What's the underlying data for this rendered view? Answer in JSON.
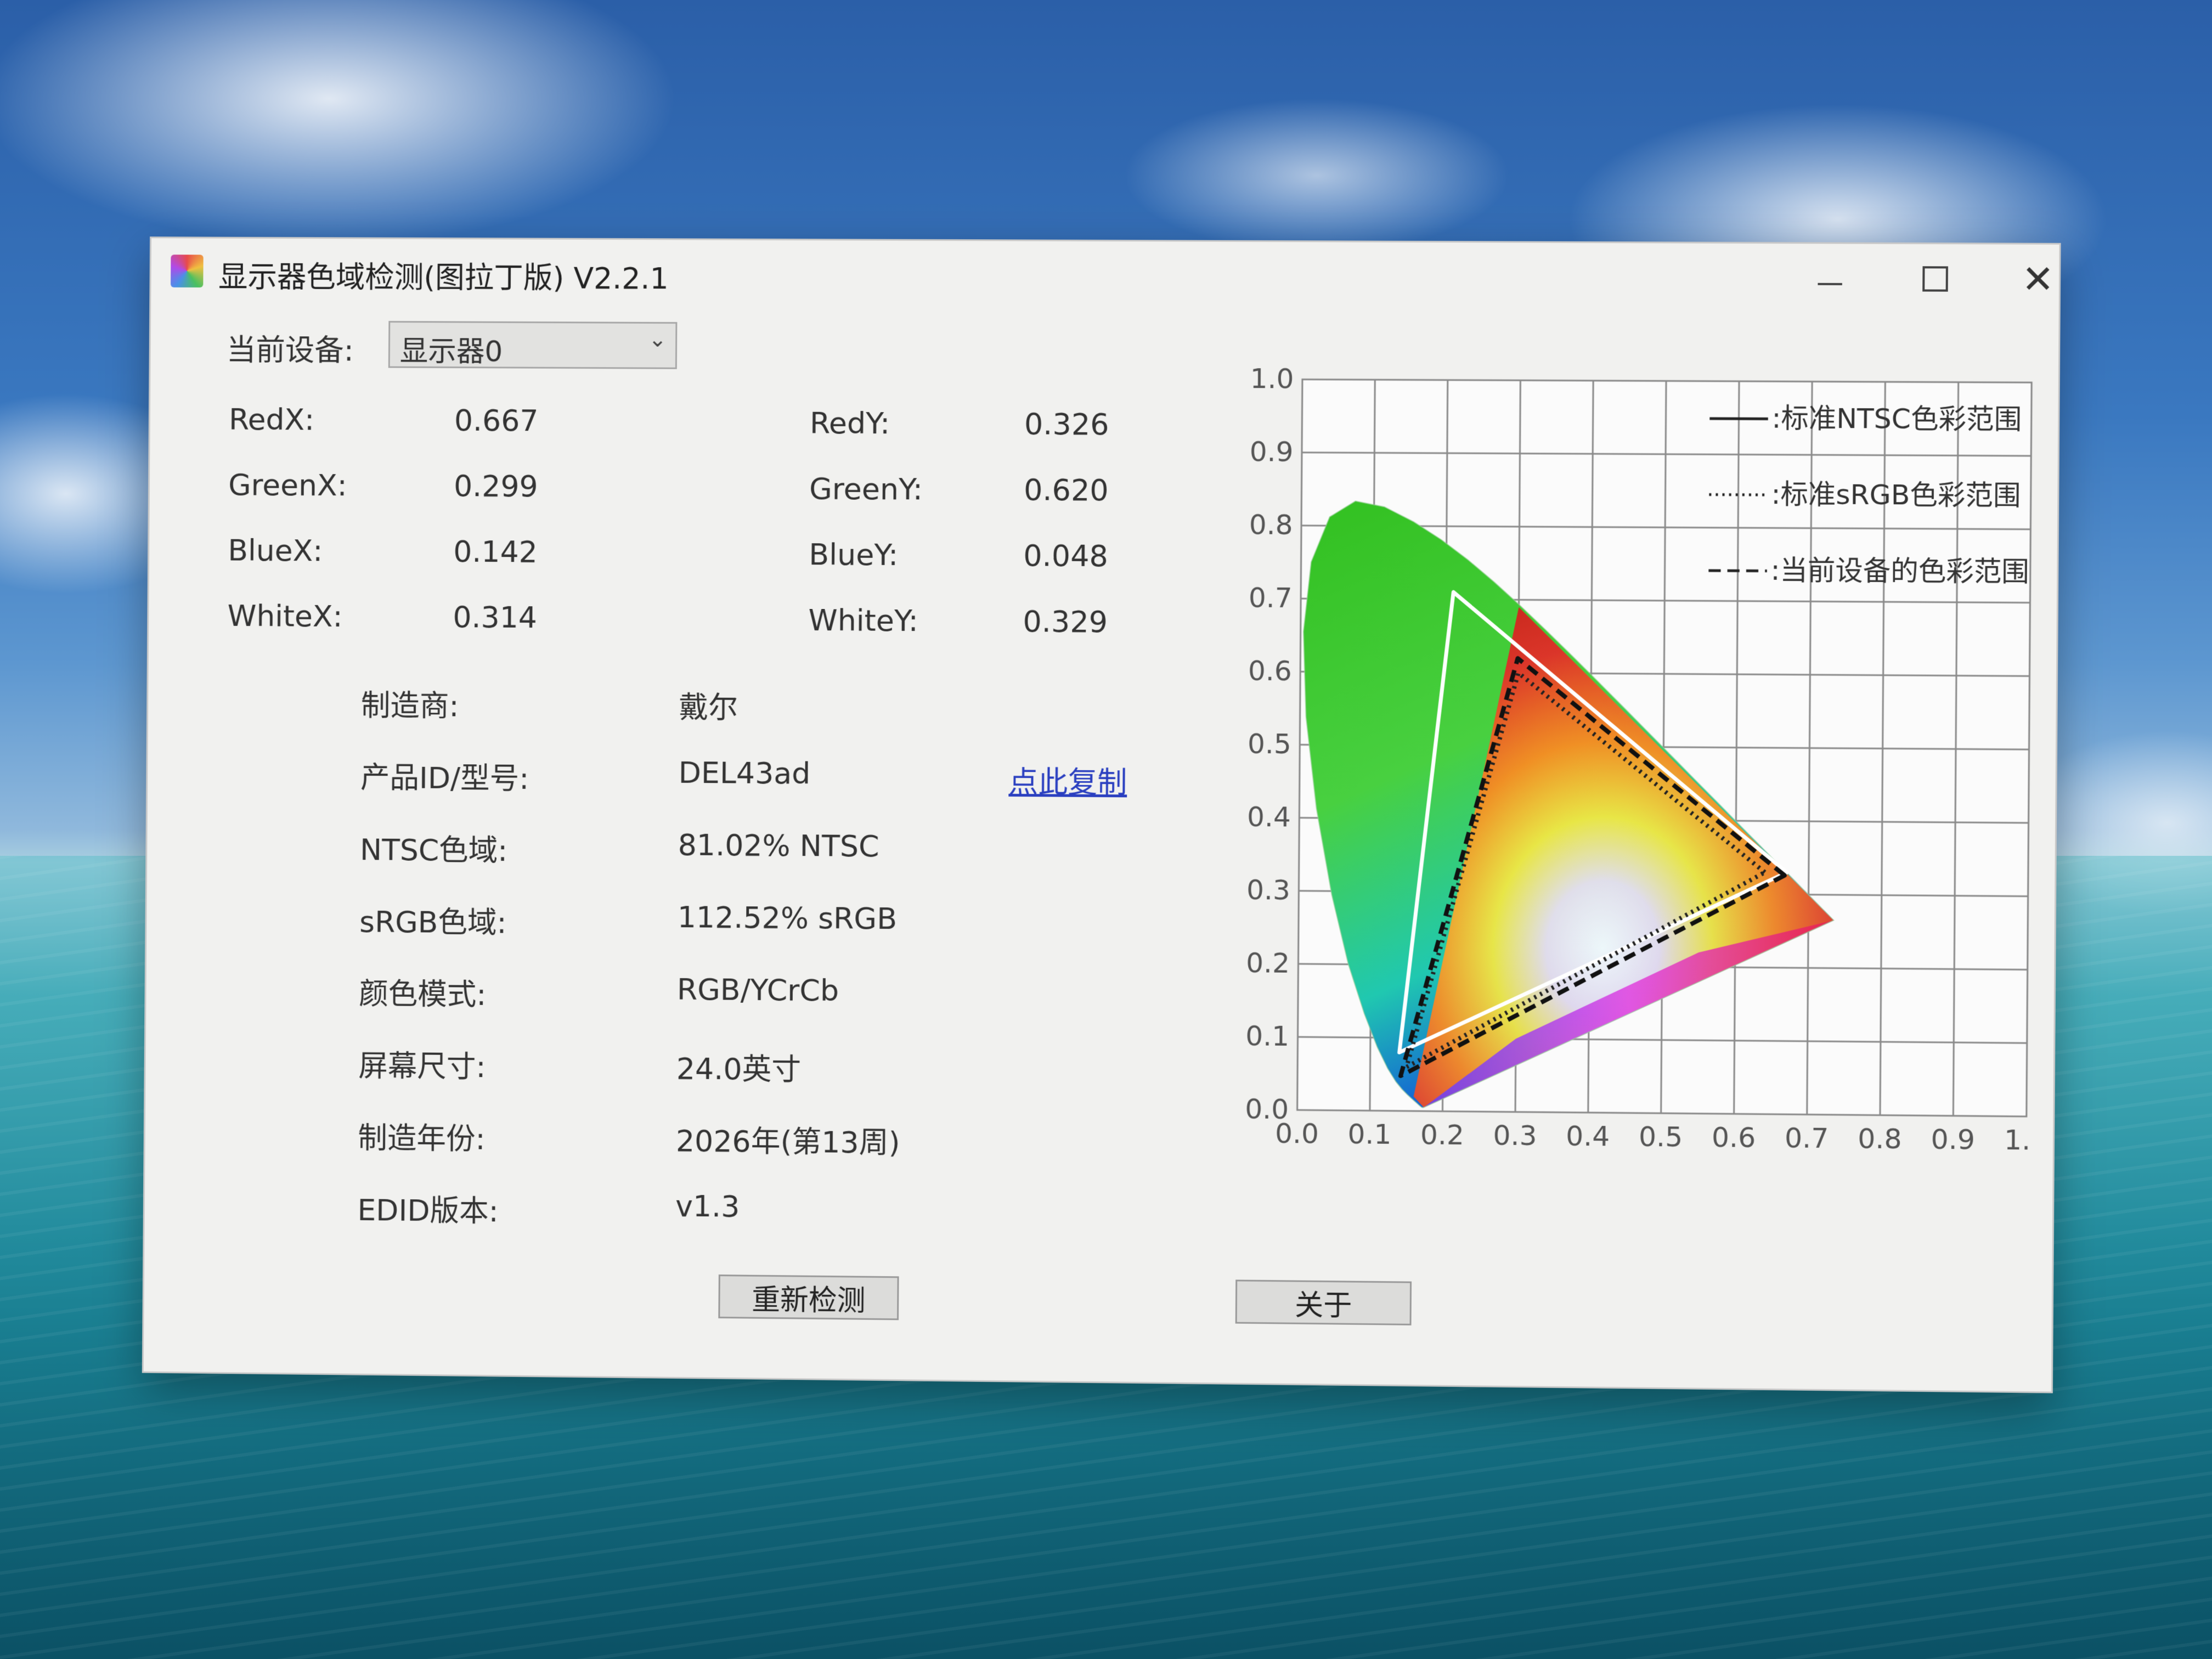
{
  "window": {
    "title": "显示器色域检测(图拉丁版) V2.2.1",
    "controls": {
      "minimize": "—",
      "maximize": "☐",
      "close": "✕"
    }
  },
  "device": {
    "label": "当前设备:",
    "selected": "显示器0"
  },
  "coords": [
    {
      "xlabel": "RedX:",
      "xval": "0.667",
      "ylabel": "RedY:",
      "yval": "0.326"
    },
    {
      "xlabel": "GreenX:",
      "xval": "0.299",
      "ylabel": "GreenY:",
      "yval": "0.620"
    },
    {
      "xlabel": "BlueX:",
      "xval": "0.142",
      "ylabel": "BlueY:",
      "yval": "0.048"
    },
    {
      "xlabel": "WhiteX:",
      "xval": "0.314",
      "ylabel": "WhiteY:",
      "yval": "0.329"
    }
  ],
  "info": [
    {
      "label": "制造商:",
      "value": "戴尔"
    },
    {
      "label": "产品ID/型号:",
      "value": "DEL43ad"
    },
    {
      "label": "NTSC色域:",
      "value": "81.02% NTSC"
    },
    {
      "label": "sRGB色域:",
      "value": "112.52% sRGB"
    },
    {
      "label": "颜色模式:",
      "value": "RGB/YCrCb"
    },
    {
      "label": "屏幕尺寸:",
      "value": "24.0英寸"
    },
    {
      "label": "制造年份:",
      "value": "2026年(第13周)"
    },
    {
      "label": "EDID版本:",
      "value": "v1.3"
    }
  ],
  "copy_link": "点此复制",
  "buttons": {
    "redetect": "重新检测",
    "about": "关于"
  },
  "chart_data": {
    "type": "scatter",
    "title": "",
    "xlim": [
      0,
      1
    ],
    "ylim": [
      0,
      1
    ],
    "x_ticks": [
      "0.0",
      "0.1",
      "0.2",
      "0.3",
      "0.4",
      "0.5",
      "0.6",
      "0.7",
      "0.8",
      "0.9",
      "1."
    ],
    "y_ticks": [
      "0.0",
      "0.1",
      "0.2",
      "0.3",
      "0.4",
      "0.5",
      "0.6",
      "0.7",
      "0.8",
      "0.9",
      "1.0"
    ],
    "grid": true,
    "legend_position": "top-right",
    "series": [
      {
        "name": "标准NTSC色彩范围",
        "style": "solid",
        "color": "#ffffff",
        "points": [
          [
            0.67,
            0.33
          ],
          [
            0.21,
            0.71
          ],
          [
            0.14,
            0.08
          ]
        ]
      },
      {
        "name": "标准sRGB色彩范围",
        "style": "dotted",
        "color": "#222222",
        "points": [
          [
            0.64,
            0.33
          ],
          [
            0.3,
            0.6
          ],
          [
            0.15,
            0.06
          ]
        ]
      },
      {
        "name": "当前设备的色彩范围",
        "style": "dashed",
        "color": "#111111",
        "points": [
          [
            0.667,
            0.326
          ],
          [
            0.299,
            0.62
          ],
          [
            0.142,
            0.048
          ]
        ]
      }
    ]
  }
}
